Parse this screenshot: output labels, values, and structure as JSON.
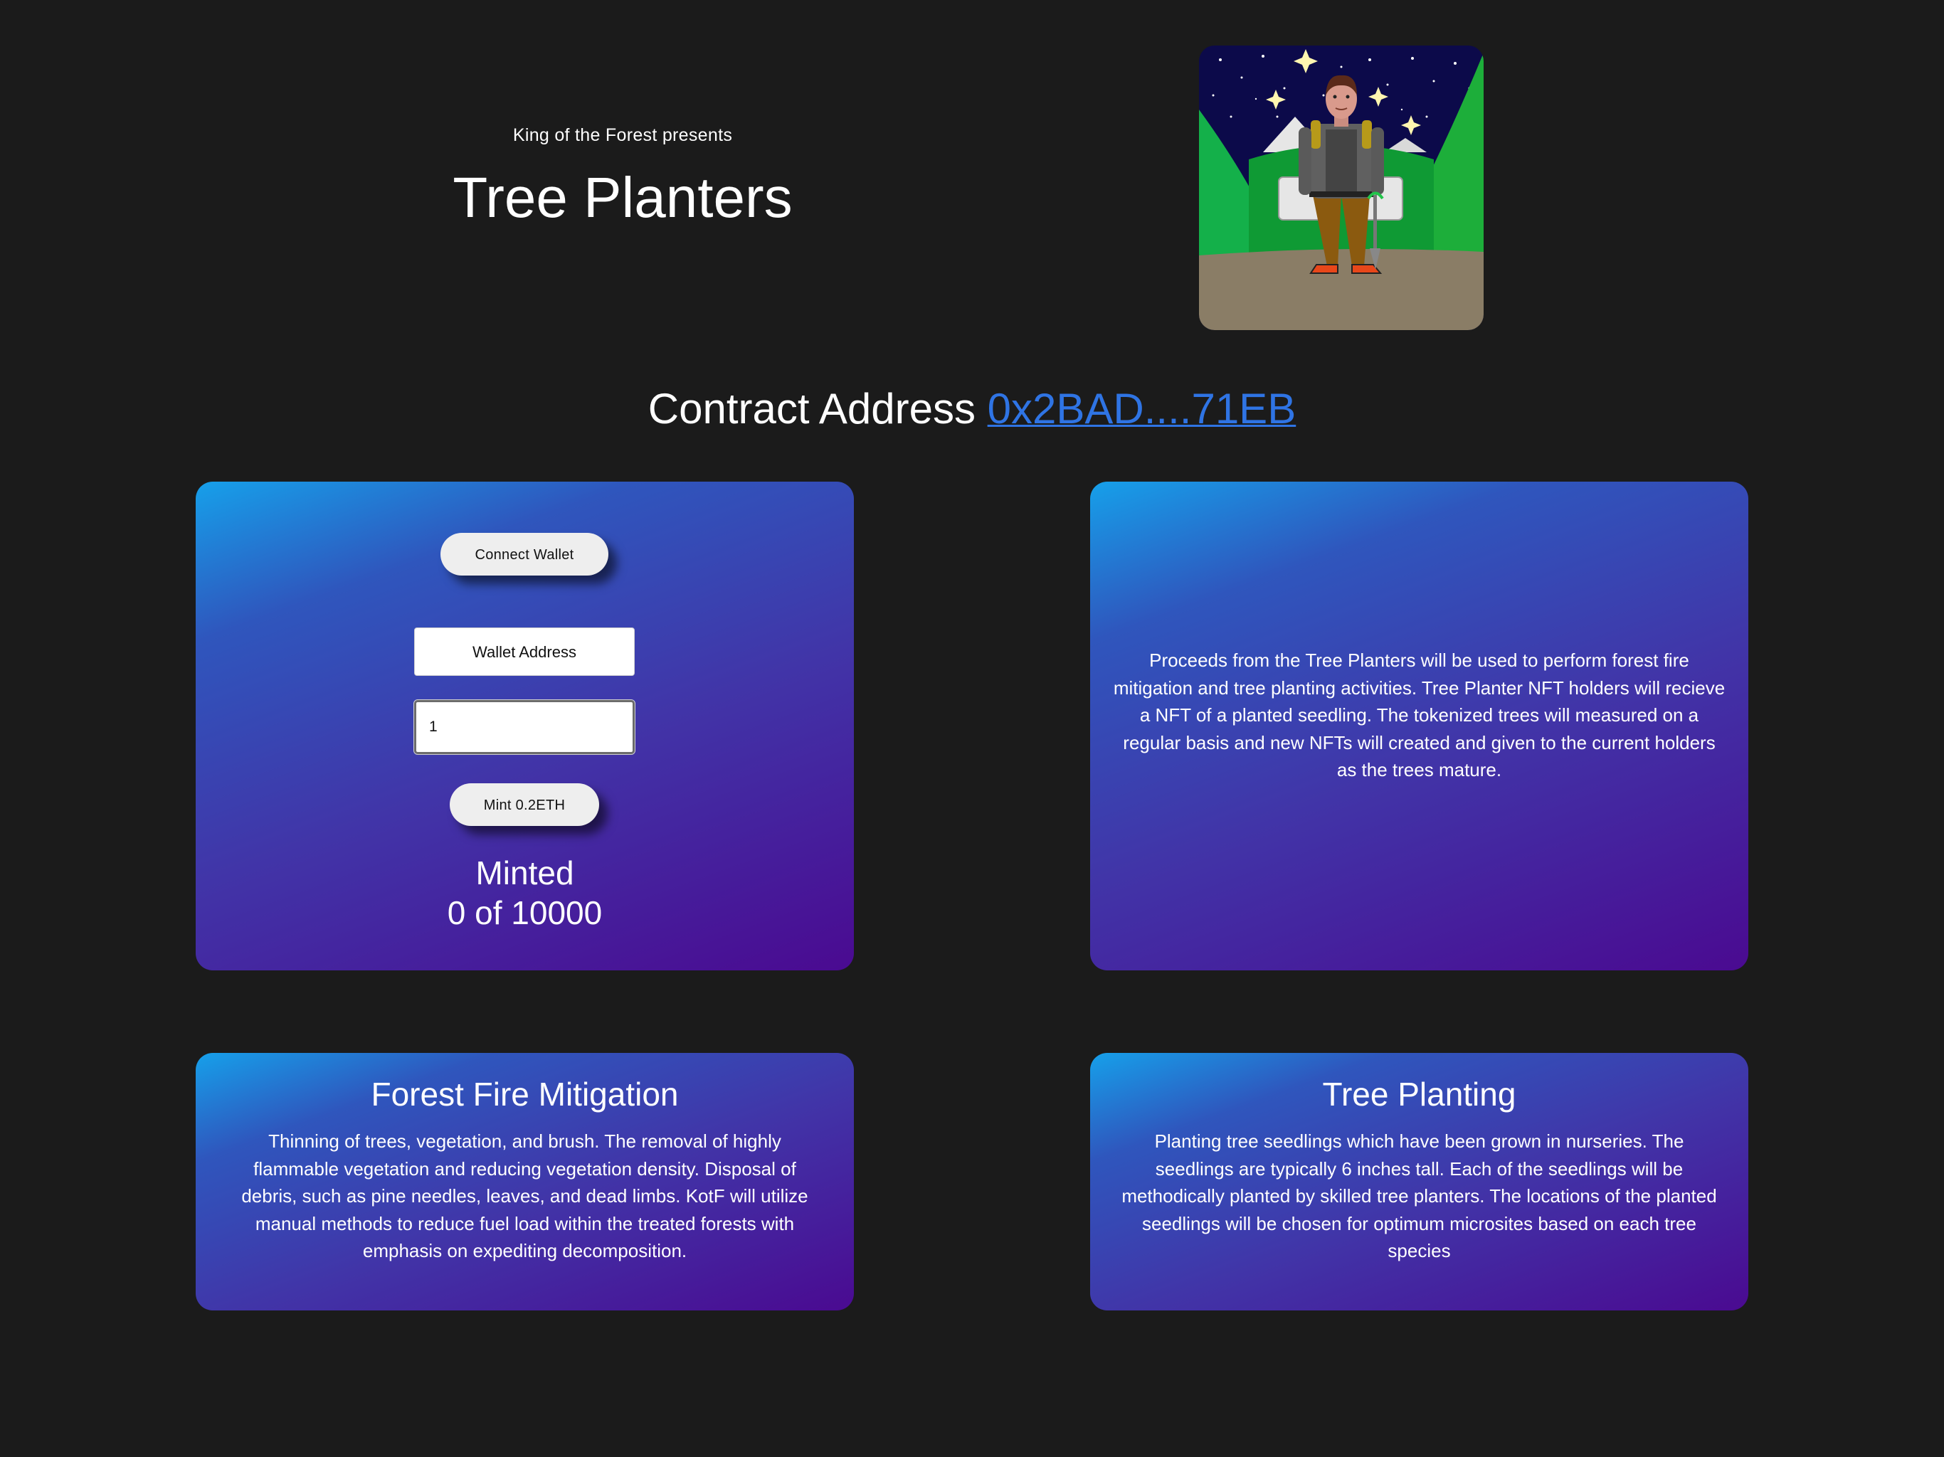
{
  "header": {
    "presents": "King of the Forest presents",
    "title": "Tree Planters"
  },
  "contract": {
    "label": "Contract Address",
    "address": "0x2BAD....71EB"
  },
  "mint_panel": {
    "connect_label": "Connect Wallet",
    "wallet_label": "Wallet Address",
    "quantity_value": "1",
    "mint_label": "Mint 0.2ETH",
    "minted_label": "Minted",
    "minted_count": "0 of 10000"
  },
  "info_panel": {
    "text": "Proceeds from the Tree Planters will be used to perform forest fire mitigation and tree planting activities. Tree Planter NFT holders will recieve a NFT of a planted seedling. The tokenized trees will measured on a regular basis and new NFTs will created and given to the current holders as the trees mature."
  },
  "fire_panel": {
    "title": "Forest Fire Mitigation",
    "text": "Thinning of trees, vegetation, and brush. The removal of highly flammable vegetation and reducing vegetation density. Disposal of debris, such as pine needles, leaves, and dead limbs. KotF will utilize manual methods to reduce fuel load within the treated forests with emphasis on expediting decomposition."
  },
  "planting_panel": {
    "title": "Tree Planting",
    "text": "Planting tree seedlings which have been grown in nurseries. The seedlings are typically 6 inches tall. Each of the seedlings will be methodically planted by skilled tree planters. The locations of the planted seedlings will be chosen for optimum microsites based on each tree species"
  },
  "colors": {
    "background": "#1b1b1b",
    "link": "#2f74e4",
    "card_gradient_start": "#16a0ea",
    "card_gradient_end": "#4a0a91"
  },
  "icons": {
    "nft_image": "tree-planter-character-illustration"
  }
}
